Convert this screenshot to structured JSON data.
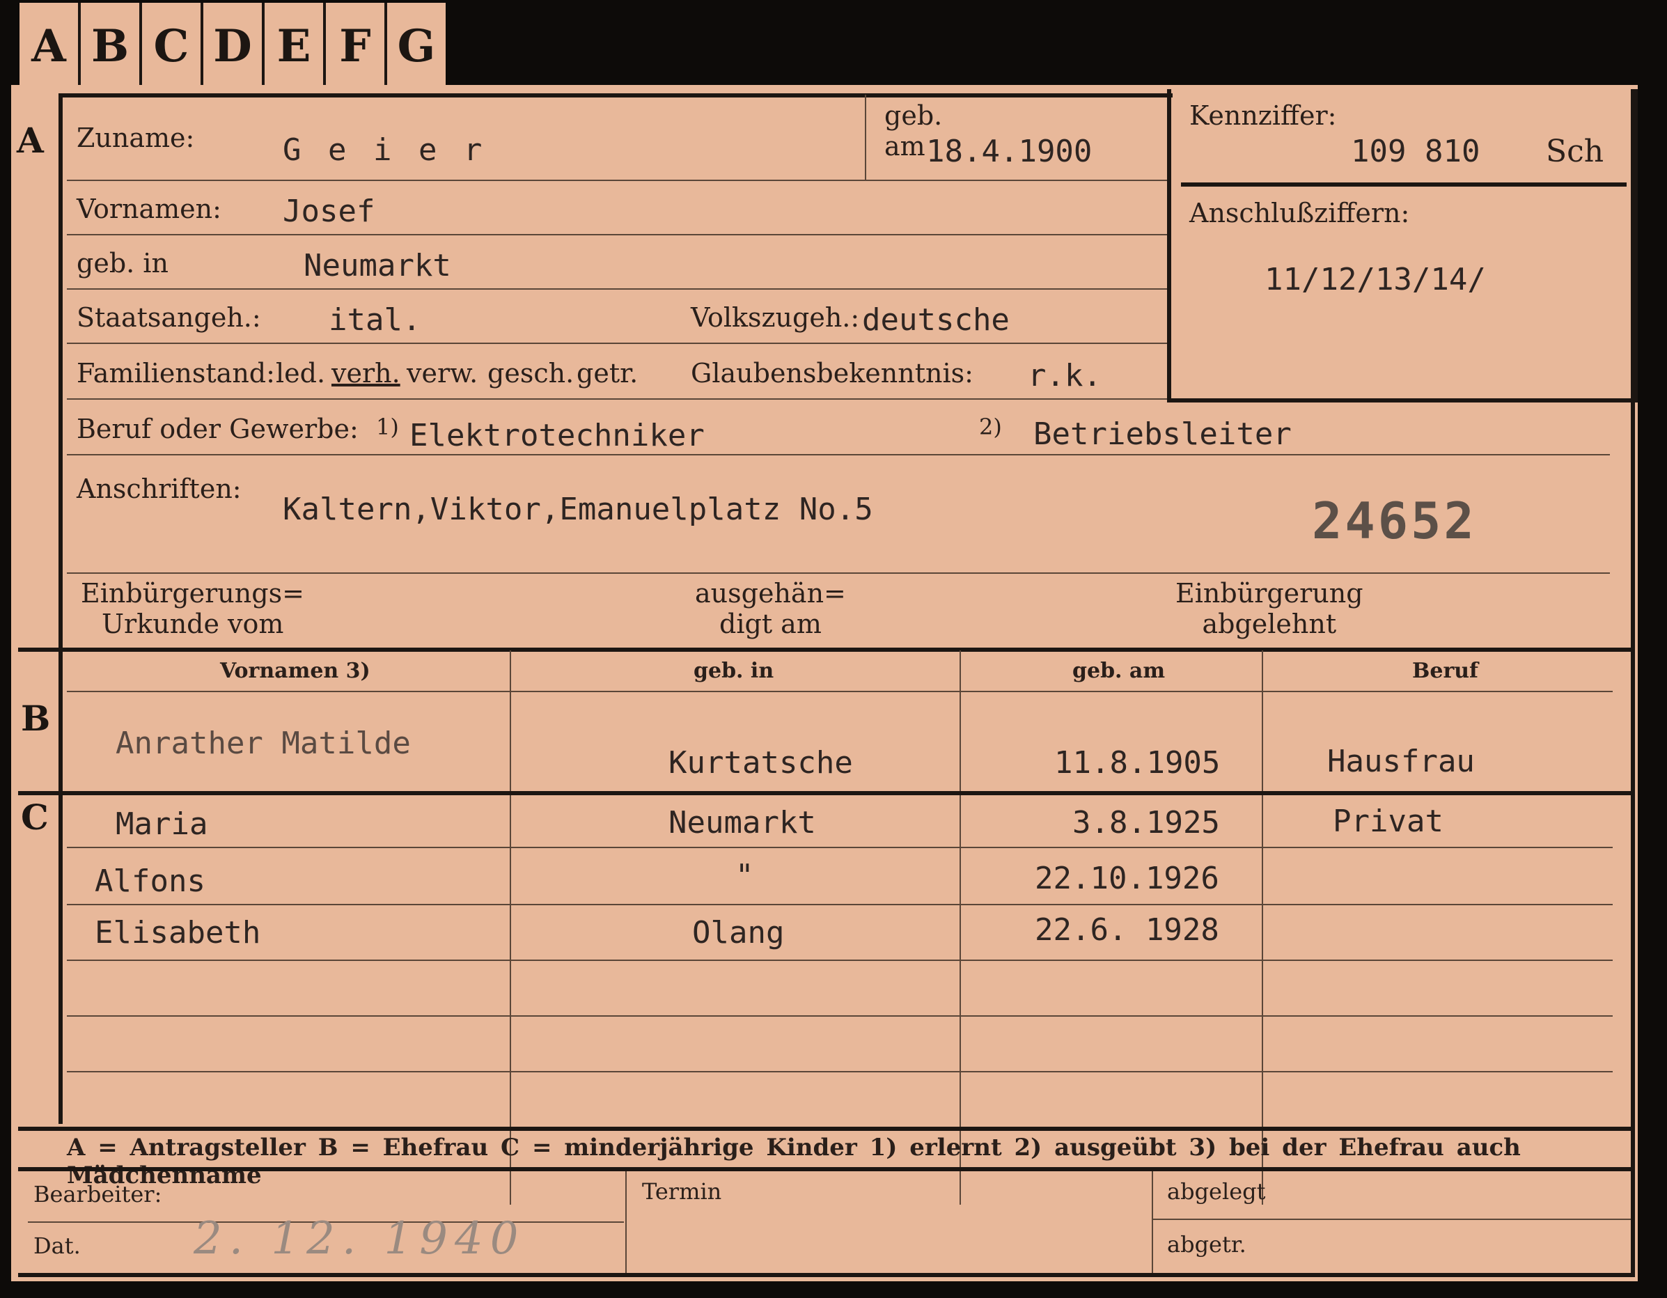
{
  "tabs": [
    "A",
    "B",
    "C",
    "D",
    "E",
    "F",
    "G"
  ],
  "sections": {
    "a": "A",
    "b": "B",
    "c": "C"
  },
  "applicant": {
    "zuname_label": "Zuname:",
    "zuname_value": "G e i e r",
    "geb_label": "geb.",
    "am_label": "am",
    "geb_am_value": "18.4.1900",
    "vornamen_label": "Vornamen:",
    "vornamen_value": "Josef",
    "geb_in_label": "geb. in",
    "geb_in_value": "Neumarkt",
    "staatsangeh_label": "Staatsangeh.:",
    "staatsangeh_value": "ital.",
    "volkszugeh_label": "Volkszugeh.:",
    "volkszugeh_value": "deutsche",
    "familienstand_label": "Familienstand:",
    "fam_options": [
      "led.",
      "verh.",
      "verw.",
      "gesch.",
      "getr."
    ],
    "fam_selected": "verh.",
    "glaubens_label": "Glaubensbekenntnis:",
    "glaubens_value": "r.k.",
    "beruf_label": "Beruf oder Gewerbe:",
    "beruf_mark1": "1)",
    "beruf_value1": "Elektrotechniker",
    "beruf_mark2": "2)",
    "beruf_value2": "Betriebsleiter",
    "anschriften_label": "Anschriften:",
    "anschriften_value": "Kaltern,Viktor,Emanuelplatz No.5",
    "stamp_number": "24652",
    "einb_urkunde_label_1": "Einbürgerungs=",
    "einb_urkunde_label_2": "Urkunde vom",
    "ausgehaendigt_label_1": "ausgehän=",
    "ausgehaendigt_label_2": "digt am",
    "einb_abgelehnt_label_1": "Einbürgerung",
    "einb_abgelehnt_label_2": "abgelehnt"
  },
  "kennziffer": {
    "label": "Kennziffer:",
    "value": "109 810",
    "suffix": "Sch",
    "anschluss_label": "Anschlußziffern:",
    "anschluss_value": "11/12/13/14/"
  },
  "family_table": {
    "headers": [
      "Vornamen 3)",
      "geb. in",
      "geb. am",
      "Beruf"
    ],
    "spouse": {
      "vornamen": "Anrather Matilde",
      "geb_in": "Kurtatsche",
      "geb_am": "11.8.1905",
      "beruf": "Hausfrau"
    },
    "children": [
      {
        "vornamen": "Maria",
        "geb_in": "Neumarkt",
        "geb_am": "3.8.1925",
        "beruf": "Privat"
      },
      {
        "vornamen": "Alfons",
        "geb_in": "\"",
        "geb_am": "22.10.1926",
        "beruf": ""
      },
      {
        "vornamen": "Elisabeth",
        "geb_in": "Olang",
        "geb_am": "22.6. 1928",
        "beruf": ""
      }
    ]
  },
  "legend": "A = Antragsteller   B = Ehefrau   C = minderjährige Kinder   1) erlernt   2) ausgeübt   3) bei der Ehefrau auch Mädchenname",
  "footer": {
    "bearbeiter_label": "Bearbeiter:",
    "dat_label": "Dat.",
    "dat_value": "2. 12. 1940",
    "termin_label": "Termin",
    "abgelegt_label": "abgelegt",
    "abgetr_label": "abgetr."
  }
}
